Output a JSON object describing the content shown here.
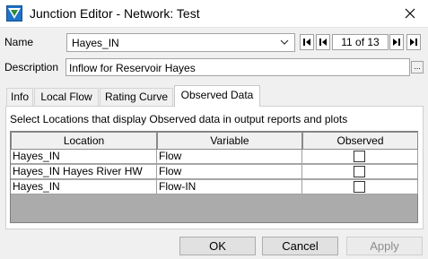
{
  "window": {
    "title": "Junction Editor - Network: Test",
    "icon": "junction-editor-icon",
    "close_icon": "close-icon"
  },
  "name_row": {
    "label": "Name",
    "value": "Hayes_IN",
    "record_indicator": "11 of 13",
    "nav_icons": [
      "first-record-icon",
      "previous-record-icon",
      "next-record-icon",
      "last-record-icon"
    ]
  },
  "description_row": {
    "label": "Description",
    "value": "Inflow for Reservoir Hayes",
    "browse_label": "..."
  },
  "tabs": [
    {
      "label": "Info",
      "active": false
    },
    {
      "label": "Local Flow",
      "active": false
    },
    {
      "label": "Rating Curve",
      "active": false
    },
    {
      "label": "Observed Data",
      "active": true
    }
  ],
  "observed_panel": {
    "instructions": "Select Locations that display Observed data in output reports and plots",
    "columns": [
      "Location",
      "Variable",
      "Observed"
    ],
    "rows": [
      {
        "location": "Hayes_IN",
        "variable": "Flow",
        "observed": false
      },
      {
        "location": "Hayes_IN Hayes River HW",
        "variable": "Flow",
        "observed": false
      },
      {
        "location": "Hayes_IN",
        "variable": "Flow-IN",
        "observed": false
      }
    ]
  },
  "buttons": {
    "ok": "OK",
    "cancel": "Cancel",
    "apply": "Apply",
    "apply_enabled": false
  },
  "colors": {
    "window_bg": "#f0f0f0",
    "title_bar_bg": "#ffffff",
    "grid_bg": "#ababab",
    "disabled_text": "#8c8c8c"
  }
}
